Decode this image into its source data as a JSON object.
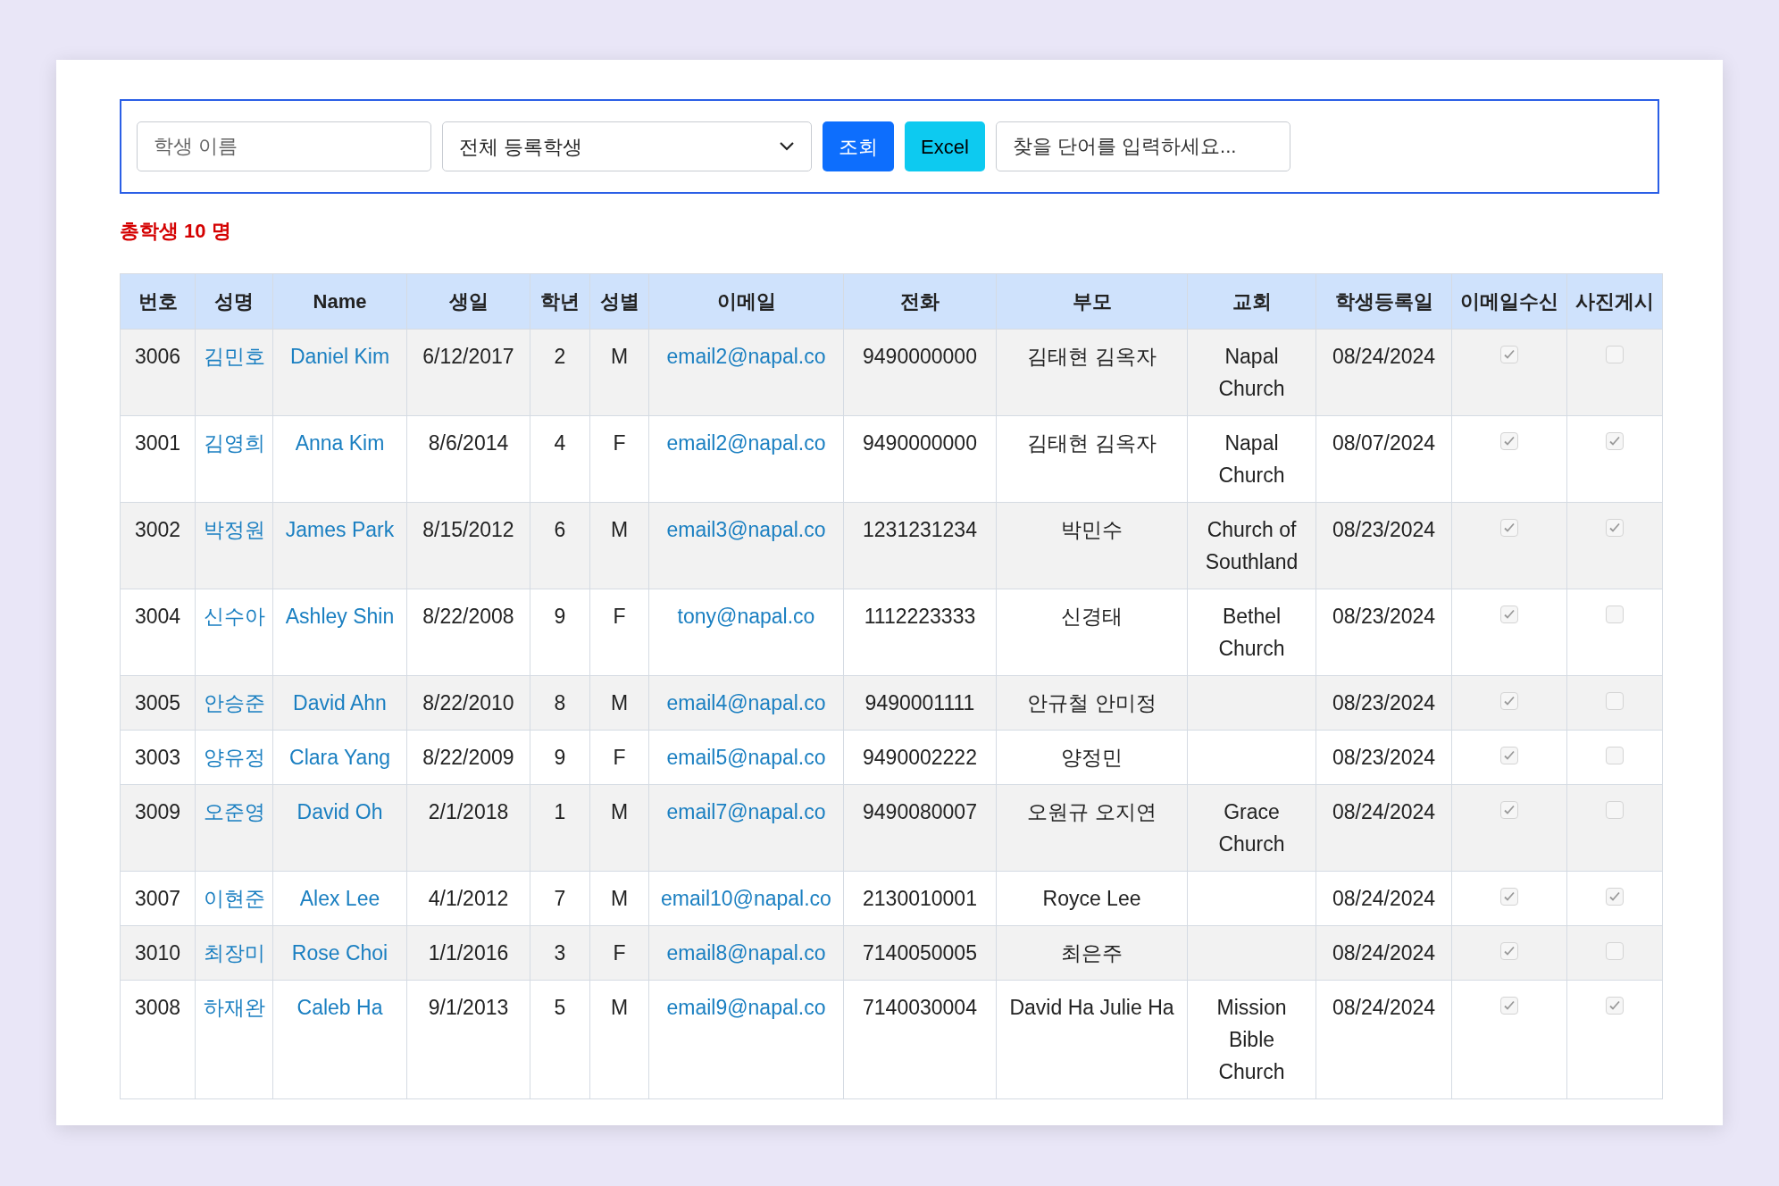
{
  "filters": {
    "name_field": {
      "placeholder": "학생 이름"
    },
    "status_select": {
      "value": "전체 등록학생"
    },
    "search_button": "조회",
    "excel_button": "Excel",
    "keyword_field": {
      "placeholder": "찾을 단어를 입력하세요..."
    }
  },
  "total": "총학생 10 명",
  "table": {
    "columns": [
      "번호",
      "성명",
      "Name",
      "생일",
      "학년",
      "성별",
      "이메일",
      "전화",
      "부모",
      "교회",
      "학생등록일",
      "이메일수신",
      "사진게시"
    ],
    "rows": [
      {
        "id": "3006",
        "korean_name": "김민호",
        "name": "Daniel Kim",
        "birthday": "6/12/2017",
        "grade": "2",
        "gender": "M",
        "email": "email2@napal.co",
        "phone": "9490000000",
        "parents": "김태현 김옥자",
        "church": "Napal Church",
        "registered": "08/24/2024",
        "email_opt_in": true,
        "photo_consent": false
      },
      {
        "id": "3001",
        "korean_name": "김영희",
        "name": "Anna Kim",
        "birthday": "8/6/2014",
        "grade": "4",
        "gender": "F",
        "email": "email2@napal.co",
        "phone": "9490000000",
        "parents": "김태현 김옥자",
        "church": "Napal Church",
        "registered": "08/07/2024",
        "email_opt_in": true,
        "photo_consent": true
      },
      {
        "id": "3002",
        "korean_name": "박정원",
        "name": "James Park",
        "birthday": "8/15/2012",
        "grade": "6",
        "gender": "M",
        "email": "email3@napal.co",
        "phone": "1231231234",
        "parents": "박민수",
        "church": "Church of Southland",
        "registered": "08/23/2024",
        "email_opt_in": true,
        "photo_consent": true
      },
      {
        "id": "3004",
        "korean_name": "신수아",
        "name": "Ashley Shin",
        "birthday": "8/22/2008",
        "grade": "9",
        "gender": "F",
        "email": "tony@napal.co",
        "phone": "1112223333",
        "parents": "신경태",
        "church": "Bethel Church",
        "registered": "08/23/2024",
        "email_opt_in": true,
        "photo_consent": false
      },
      {
        "id": "3005",
        "korean_name": "안승준",
        "name": "David Ahn",
        "birthday": "8/22/2010",
        "grade": "8",
        "gender": "M",
        "email": "email4@napal.co",
        "phone": "9490001111",
        "parents": "안규철 안미정",
        "registered": "08/23/2024",
        "email_opt_in": true,
        "photo_consent": false
      },
      {
        "id": "3003",
        "korean_name": "양유정",
        "name": "Clara Yang",
        "birthday": "8/22/2009",
        "grade": "9",
        "gender": "F",
        "email": "email5@napal.co",
        "phone": "9490002222",
        "parents": "양정민",
        "registered": "08/23/2024",
        "email_opt_in": true,
        "photo_consent": false
      },
      {
        "id": "3009",
        "korean_name": "오준영",
        "name": "David Oh",
        "birthday": "2/1/2018",
        "grade": "1",
        "gender": "M",
        "email": "email7@napal.co",
        "phone": "9490080007",
        "parents": "오원규 오지연",
        "church": "Grace Church",
        "registered": "08/24/2024",
        "email_opt_in": true,
        "photo_consent": false
      },
      {
        "id": "3007",
        "korean_name": "이현준",
        "name": "Alex Lee",
        "birthday": "4/1/2012",
        "grade": "7",
        "gender": "M",
        "email": "email10@napal.co",
        "phone": "2130010001",
        "parents": "Royce Lee",
        "registered": "08/24/2024",
        "email_opt_in": true,
        "photo_consent": true
      },
      {
        "id": "3010",
        "korean_name": "최장미",
        "name": "Rose Choi",
        "birthday": "1/1/2016",
        "grade": "3",
        "gender": "F",
        "email": "email8@napal.co",
        "phone": "7140050005",
        "parents": "최은주",
        "registered": "08/24/2024",
        "email_opt_in": true,
        "photo_consent": false
      },
      {
        "id": "3008",
        "korean_name": "하재완",
        "name": "Caleb Ha",
        "birthday": "9/1/2013",
        "grade": "5",
        "gender": "M",
        "email": "email9@napal.co",
        "phone": "7140030004",
        "parents": "David Ha Julie Ha",
        "church": "Mission Bible Church",
        "registered": "08/24/2024",
        "email_opt_in": true,
        "photo_consent": true
      }
    ]
  }
}
